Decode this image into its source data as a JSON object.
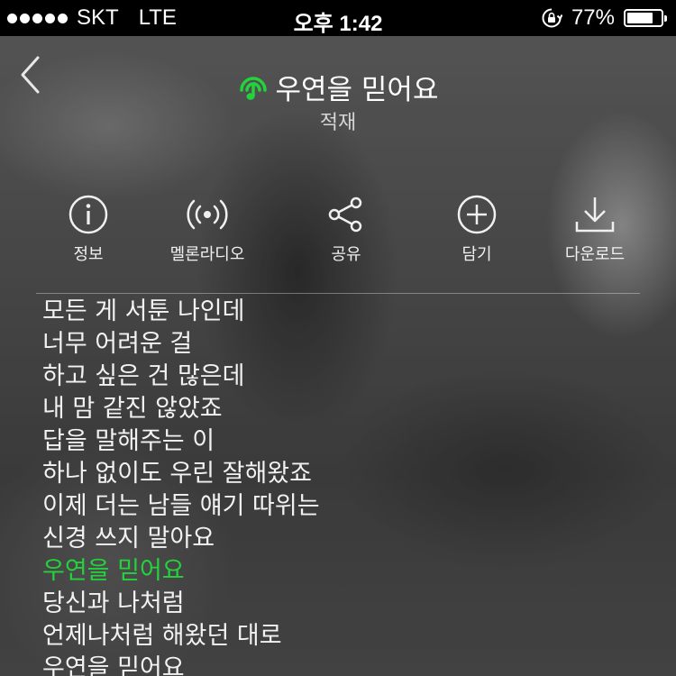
{
  "status_bar": {
    "carrier": "SKT",
    "network": "LTE",
    "time": "오후 1:42",
    "battery": "77%",
    "battery_level": 0.77
  },
  "header": {
    "title": "우연을 믿어요",
    "artist": "적재",
    "accent_color": "#22d33c"
  },
  "actions": [
    {
      "label": "정보",
      "icon": "info-icon"
    },
    {
      "label": "멜론라디오",
      "icon": "radio-icon"
    },
    {
      "label": "공유",
      "icon": "share-icon"
    },
    {
      "label": "담기",
      "icon": "add-icon"
    },
    {
      "label": "다운로드",
      "icon": "download-icon"
    }
  ],
  "lyrics": [
    {
      "text": "모든 게 서툰 나인데",
      "active": false
    },
    {
      "text": "너무 어려운 걸",
      "active": false
    },
    {
      "text": "하고 싶은 건 많은데",
      "active": false
    },
    {
      "text": "내 맘 같진 않았죠",
      "active": false
    },
    {
      "text": "답을 말해주는 이",
      "active": false
    },
    {
      "text": "하나 없이도 우린 잘해왔죠",
      "active": false
    },
    {
      "text": "이제 더는 남들 얘기 따위는",
      "active": false
    },
    {
      "text": "신경 쓰지 말아요",
      "active": false
    },
    {
      "text": "우연을 믿어요",
      "active": true
    },
    {
      "text": "당신과 나처럼",
      "active": false
    },
    {
      "text": "언제나처럼 해왔던 대로",
      "active": false
    },
    {
      "text": "우연을 믿어요",
      "active": false
    }
  ]
}
